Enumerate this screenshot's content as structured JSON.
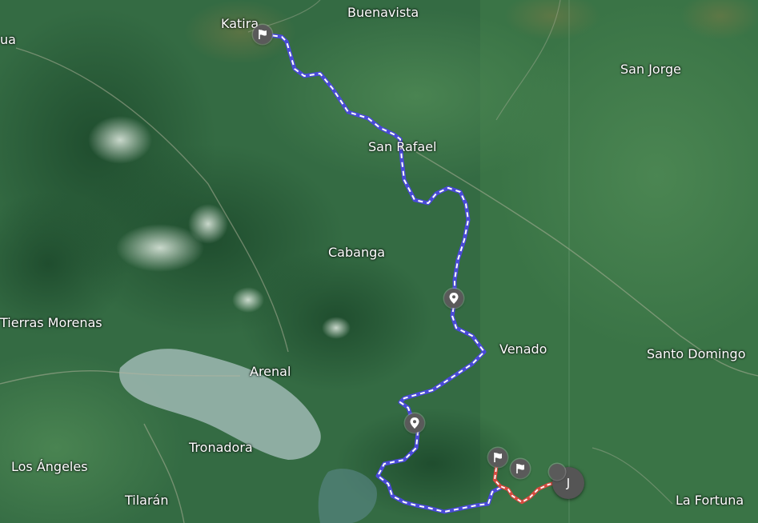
{
  "map": {
    "places": [
      {
        "id": "katira",
        "name": "Katira"
      },
      {
        "id": "buenavista",
        "name": "Buenavista"
      },
      {
        "id": "ua",
        "name": "ua"
      },
      {
        "id": "san-jorge",
        "name": "San Jorge"
      },
      {
        "id": "san-rafael",
        "name": "San Rafael"
      },
      {
        "id": "cabanga",
        "name": "Cabanga"
      },
      {
        "id": "tierras-morenas",
        "name": "Tierras Morenas"
      },
      {
        "id": "venado",
        "name": "Venado"
      },
      {
        "id": "santo-domingo",
        "name": "Santo Domingo"
      },
      {
        "id": "arenal",
        "name": "Arenal"
      },
      {
        "id": "tronadora",
        "name": "Tronadora"
      },
      {
        "id": "los-angeles",
        "name": "Los Ángeles"
      },
      {
        "id": "tilaran",
        "name": "Tilarán"
      },
      {
        "id": "la-fortuna",
        "name": "La Fortuna"
      }
    ],
    "markers": [
      {
        "id": "start-flag-katira",
        "icon": "flag-icon"
      },
      {
        "id": "waypoint-1",
        "icon": "map-pin-icon"
      },
      {
        "id": "waypoint-2",
        "icon": "map-pin-icon"
      },
      {
        "id": "flag-south-1",
        "icon": "flag-icon"
      },
      {
        "id": "flag-south-2",
        "icon": "flag-icon"
      }
    ],
    "cluster": {
      "label": "J",
      "icon": "cluster-icon"
    },
    "routes": [
      {
        "id": "blue-route",
        "color": "#5b5be6",
        "style": "dashed"
      },
      {
        "id": "red-route",
        "color": "#e2574c",
        "style": "dashed"
      }
    ],
    "colors": {
      "forest": "#2f6a40",
      "lake": "#9fb8b3",
      "marker": "#5a5a5a"
    }
  }
}
